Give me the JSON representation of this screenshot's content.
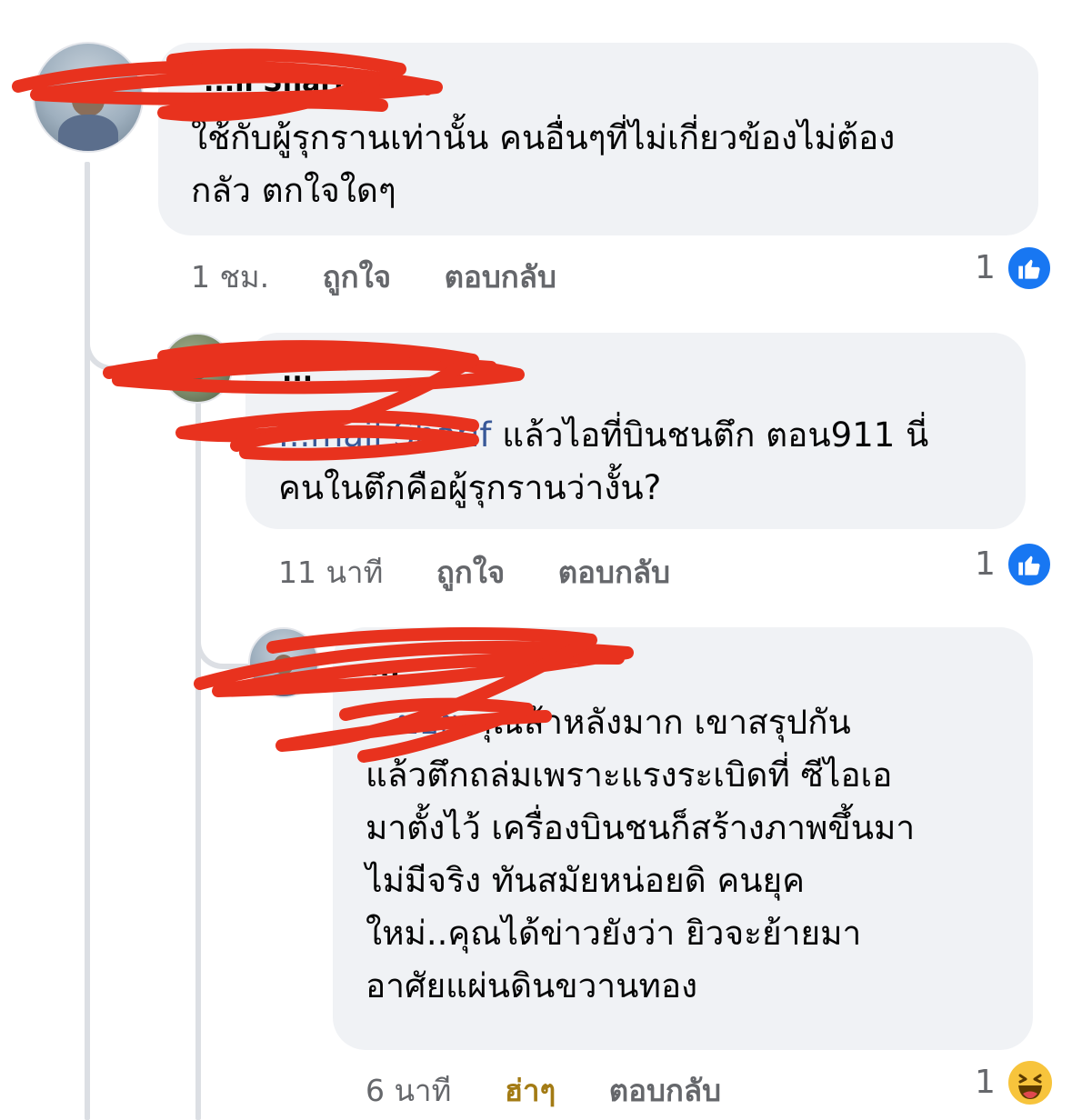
{
  "comments": [
    {
      "name": "...il Sharif",
      "lines": [
        "ใช้กับผู้รุกรานเท่านั้น คนอื่นๆที่ไม่เกี่ยวข้องไม่ต้อง",
        "กลัว ตกใจใดๆ"
      ],
      "time": "1 ชม.",
      "like_label": "ถูกใจ",
      "reply_label": "ตอบกลับ",
      "reaction_count": "1",
      "reaction_icon": "like-icon"
    },
    {
      "name": "...",
      "mention": "...mail Sharif",
      "lines_first": "แล้วไอที่บินชนตึก ตอน911 นี่",
      "lines": [
        "คนในตึกคือผู้รุกรานว่างั้น?"
      ],
      "time": "11 นาที",
      "like_label": "ถูกใจ",
      "reply_label": "ตอบกลับ",
      "reaction_count": "1",
      "reaction_icon": "like-icon"
    },
    {
      "name": "...",
      "mention": "...บอย",
      "lines_first": "คุณล้าหลังมาก  เขาสรุปกัน",
      "lines": [
        "แล้วตึกถล่มเพราะแรงระเบิดที่ ซีไอเอ",
        "มาตั้งไว้ เครื่องบินชนก็สร้างภาพขึ้นมา",
        "ไม่มีจริง  ทันสมัยหน่อยดิ คนยุค",
        "ใหม่..คุณได้ข่าวยังว่า ยิวจะย้ายมา",
        "อาศัยแผ่นดินขวานทอง"
      ],
      "time": "6 นาที",
      "like_label": "ฮ่าๆ",
      "reply_label": "ตอบกลับ",
      "reaction_count": "1",
      "reaction_icon": "haha-icon"
    }
  ],
  "colors": {
    "bubble": "#f0f2f5",
    "meta_text": "#65676b",
    "mention": "#385898",
    "like_blue": "#1877f2",
    "haha_gold": "#a37b14",
    "redaction": "#e8321e"
  }
}
